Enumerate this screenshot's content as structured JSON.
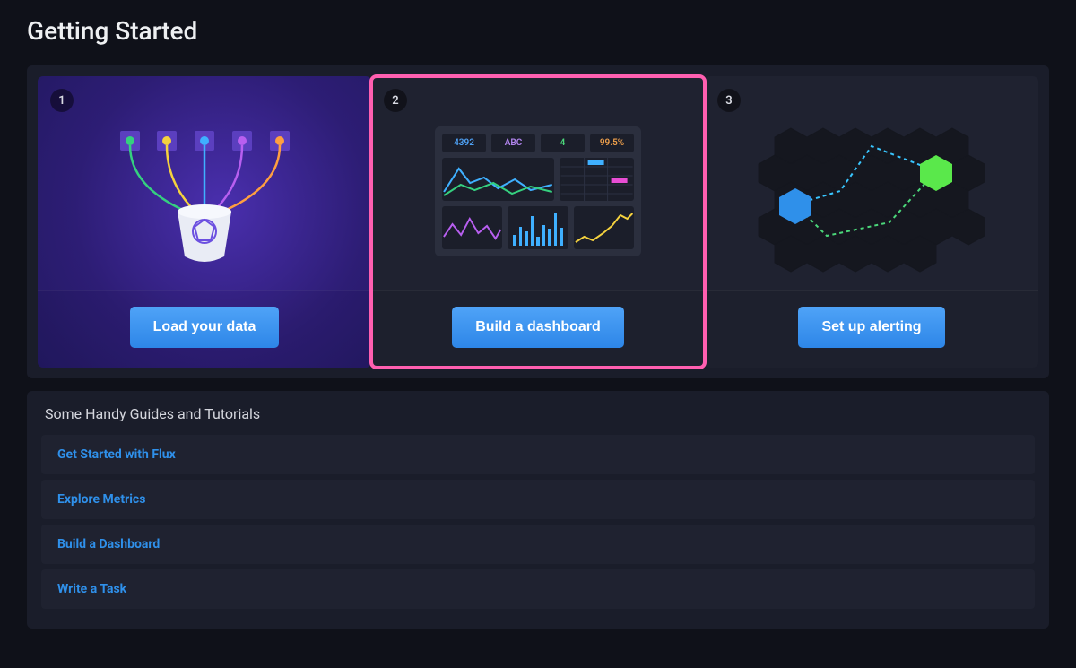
{
  "page_title": "Getting Started",
  "steps": [
    {
      "num": "1",
      "button_label": "Load your data"
    },
    {
      "num": "2",
      "button_label": "Build a dashboard"
    },
    {
      "num": "3",
      "button_label": "Set up alerting"
    }
  ],
  "dashboard_illustration": {
    "stats": [
      "4392",
      "ABC",
      "4",
      "99.5%"
    ]
  },
  "guides": {
    "title": "Some Handy Guides and Tutorials",
    "items": [
      "Get Started with Flux",
      "Explore Metrics",
      "Build a Dashboard",
      "Write a Task"
    ]
  },
  "colors": {
    "accent_blue": "#3495eb",
    "highlight_pink": "#ff5fb0"
  }
}
